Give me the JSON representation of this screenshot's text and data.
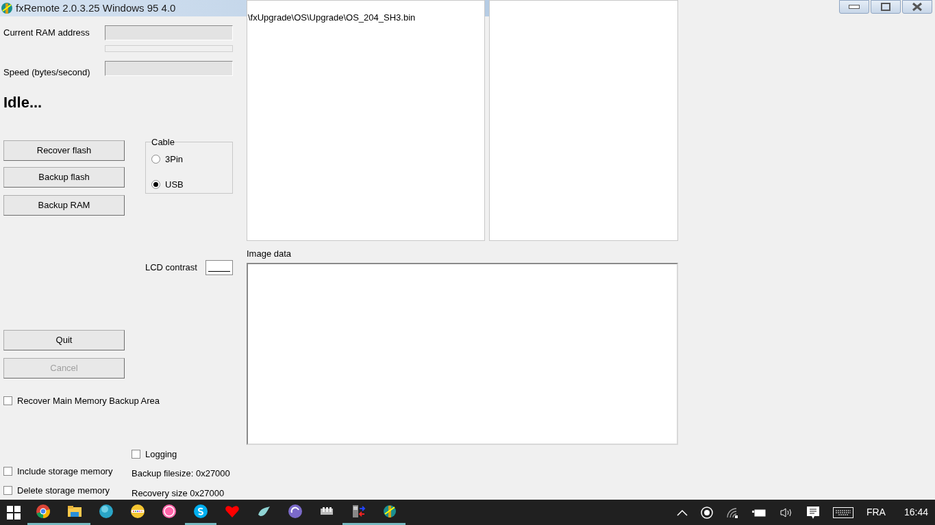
{
  "window": {
    "title": "fxRemote 2.0.3.25 Windows 95 4.0"
  },
  "fields": [
    {
      "label": "Current RAM address"
    },
    {
      "label": "Speed (bytes/second)"
    }
  ],
  "status": "Idle...",
  "actions": [
    {
      "label": "Recover flash",
      "disabled": false
    },
    {
      "label": "Backup flash",
      "disabled": false
    },
    {
      "label": "Backup RAM",
      "disabled": false
    }
  ],
  "cable": {
    "title": "Cable",
    "options": [
      {
        "label": "3Pin",
        "selected": false
      },
      {
        "label": "USB",
        "selected": true
      }
    ]
  },
  "lcd_contrast": {
    "label": "LCD contrast"
  },
  "controls": [
    {
      "label": "Quit",
      "disabled": false
    },
    {
      "label": "Cancel",
      "disabled": true
    }
  ],
  "recover_main": {
    "label": "Recover Main Memory Backup Area",
    "checked": false
  },
  "storage_options": [
    {
      "label": "Include storage memory",
      "checked": false
    },
    {
      "label": "Delete storage memory",
      "checked": false
    }
  ],
  "logging": {
    "label": "Logging",
    "checked": false
  },
  "info": [
    "Backup filesize: 0x27000",
    "Recovery size 0x27000"
  ],
  "file_list": [
    "\\fxUpgrade\\OS\\Upgrade\\OS_204_SH3.bin"
  ],
  "image_data": {
    "label": "Image data"
  },
  "taskbar": {
    "apps": [
      {
        "kind": "chrome",
        "running": true
      },
      {
        "kind": "folder",
        "running": true
      },
      {
        "kind": "globe",
        "running": false
      },
      {
        "kind": "dots",
        "running": false
      },
      {
        "kind": "pink",
        "running": false
      },
      {
        "kind": "skype",
        "running": true
      },
      {
        "kind": "heart",
        "running": false
      },
      {
        "kind": "bird",
        "running": false
      },
      {
        "kind": "torrent",
        "running": false
      },
      {
        "kind": "blocks",
        "running": false
      },
      {
        "kind": "phone",
        "running": true
      },
      {
        "kind": "fx",
        "running": true
      }
    ],
    "language": "FRA",
    "time": "16:44"
  }
}
